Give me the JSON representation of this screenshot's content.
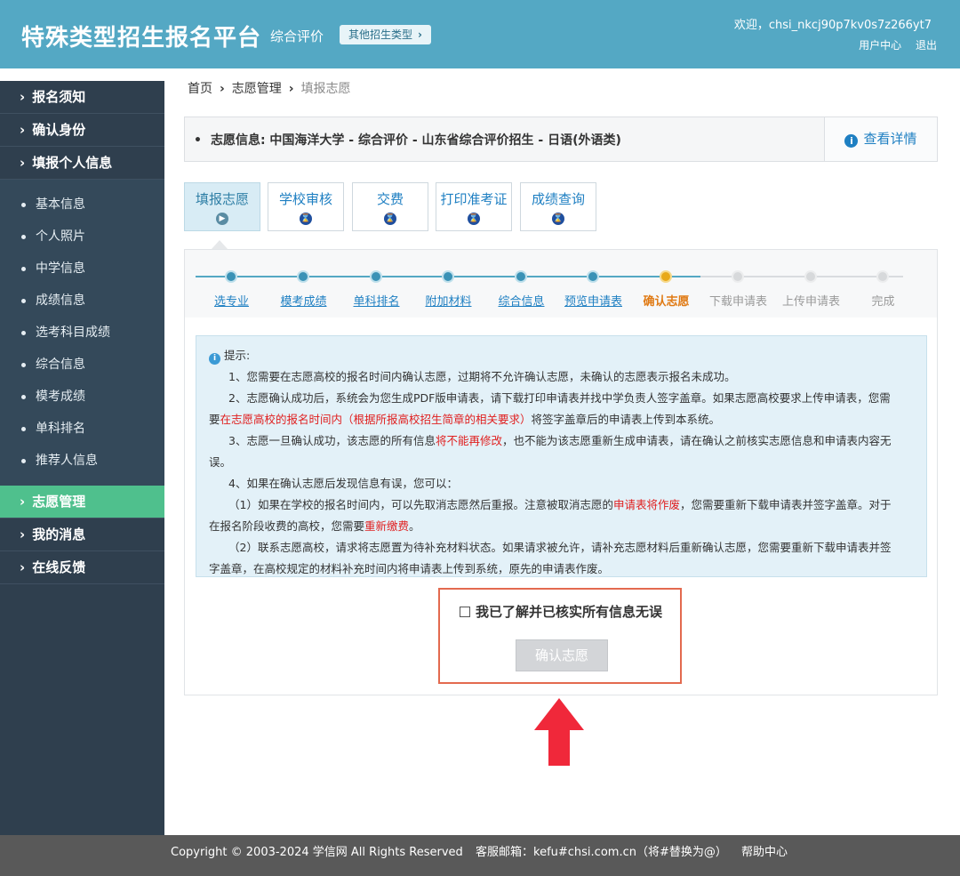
{
  "header": {
    "brand": "特殊类型招生报名平台",
    "subtitle": "综合评价",
    "other_btn": "其他招生类型",
    "welcome": "欢迎，chsi_nkcj90p7kv0s7z266yt7",
    "user_center": "用户中心",
    "logout": "退出"
  },
  "sidebar": {
    "main_top": [
      "报名须知",
      "确认身份",
      "填报个人信息"
    ],
    "sub_items": [
      "基本信息",
      "个人照片",
      "中学信息",
      "成绩信息",
      "选考科目成绩",
      "综合信息",
      "模考成绩",
      "单科排名",
      "推荐人信息"
    ],
    "active": "志愿管理",
    "main_bottom": [
      "我的消息",
      "在线反馈"
    ]
  },
  "breadcrumb": {
    "home": "首页",
    "section": "志愿管理",
    "current": "填报志愿"
  },
  "info": {
    "text": "志愿信息:  中国海洋大学 - 综合评价 - 山东省综合评价招生 - 日语(外语类)",
    "detail": "查看详情"
  },
  "tabs": [
    "填报志愿",
    "学校审核",
    "交费",
    "打印准考证",
    "成绩查询"
  ],
  "steps": {
    "labels": [
      "选专业",
      "模考成绩",
      "单科排名",
      "附加材料",
      "综合信息",
      "预览申请表",
      "确认志愿",
      "下载申请表",
      "上传申请表",
      "完成"
    ],
    "current_index": 6
  },
  "notice": {
    "title": "提示:",
    "l1": "1、您需要在志愿高校的报名时间内确认志愿，过期将不允许确认志愿，未确认的志愿表示报名未成功。",
    "l2a": "2、志愿确认成功后，系统会为您生成PDF版申请表，请下载打印申请表并找中学负责人签字盖章。如果志愿高校要求上传申请表，您需",
    "l2b_pre": "要",
    "l2b_red": "在志愿高校的报名时间内（根据所报高校招生简章的相关要求）",
    "l2b_post": "将签字盖章后的申请表上传到本系统。",
    "l3_pre": "3、志愿一旦确认成功，该志愿的所有信息",
    "l3_red": "将不能再修改",
    "l3_post": "，也不能为该志愿重新生成申请表，请在确认之前核实志愿信息和申请表内容无",
    "l3b": "误。",
    "l4": "4、如果在确认志愿后发现信息有误，您可以：",
    "l5_pre": "（1）如果在学校的报名时间内，可以先取消志愿然后重报。注意被取消志愿的",
    "l5_red": "申请表将作废",
    "l5_post": "，您需要重新下载申请表并签字盖章。对于",
    "l5b_pre": "在报名阶段收费的高校，您需要",
    "l5b_red": "重新缴费",
    "l5b_post": "。",
    "l6a": "（2）联系志愿高校，请求将志愿置为待补充材料状态。如果请求被允许，请补充志愿材料后重新确认志愿，您需要重新下载申请表并签",
    "l6b": "字盖章，在高校规定的材料补充时间内将申请表上传到系统，原先的申请表作废。"
  },
  "confirm": {
    "checkbox_label": "我已了解并已核实所有信息无误",
    "button": "确认志愿"
  },
  "footer": {
    "copyright": "Copyright © 2003-2024 学信网 All Rights Reserved",
    "email": "客服邮箱：kefu#chsi.com.cn（将#替换为@）",
    "help": "帮助中心"
  },
  "colors": {
    "header": "#54a8c4",
    "sidebar": "#2f3f4e",
    "active_nav": "#4fc08d",
    "arrow": "#f0283a"
  }
}
